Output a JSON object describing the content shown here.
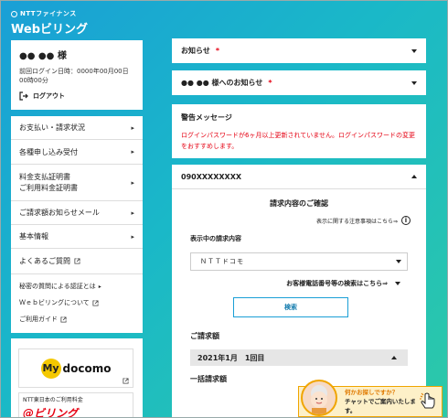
{
  "brand": {
    "company": "NTTファイナンス",
    "service": "Webビリング"
  },
  "user": {
    "name": "●● ●● 様",
    "last_login": "前回ログイン日時：0000年00月00日00時00分",
    "logout_label": "ログアウト"
  },
  "menu": {
    "items": [
      {
        "label": "お支払い・請求状況"
      },
      {
        "label": "各種申し込み受付"
      },
      {
        "label_line1": "料金支払証明書",
        "label_line2": "ご利用料金証明書"
      },
      {
        "label": "ご請求額お知らせメール"
      },
      {
        "label": "基本情報"
      }
    ],
    "faq": "よくあるご質問",
    "links": [
      "秘密の質問による認証とは",
      "Ｗｅｂビリングについて",
      "ご利用ガイド"
    ]
  },
  "banners": {
    "docomo_my": "My",
    "docomo_name": "docomo",
    "ntt_east_text": "NTT東日本のご利用料金",
    "ntt_east_logo": "@ビリング"
  },
  "panels": {
    "news_title": "お知らせ",
    "notice_title": "●● ●● 様へのお知らせ",
    "required_mark": "*",
    "warning_title": "警告メッセージ",
    "warning_text": "ログインパスワードが6ヶ月以上更新されていません。ログインパスワードの変更をおすすめします。"
  },
  "billing": {
    "phone_number": "090XXXXXXXX",
    "section_title": "請求内容のご確認",
    "notes_link": "表示に関する注意事項はこちら⇒",
    "display_label": "表示中の請求内容",
    "selected_provider": "ＮＴＴドコモ",
    "customer_search_link": "お客様電話番号等の検索はこちら⇒",
    "search_button": "検索",
    "amount_heading": "ご請求額",
    "period": "2021年1月　1回目",
    "lump_heading": "一括請求額"
  },
  "chat": {
    "line1": "何かお探しですか？",
    "line2": "チャットでご案内いたします。"
  },
  "colors": {
    "accent": "#1a9fd6",
    "warning": "#e50012",
    "chat_border": "#f0a500"
  }
}
